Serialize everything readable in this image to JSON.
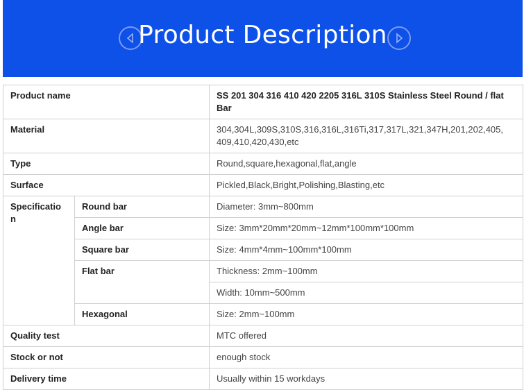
{
  "banner": {
    "title": "Product Description",
    "bg_color": "#0e51e8",
    "prev_icon": "triangle-left-circle-icon",
    "next_icon": "triangle-right-circle-icon"
  },
  "table": {
    "product_name": {
      "label": "Product name",
      "value": "SS 201 304 316 410 420 2205 316L 310S Stainless Steel Round / flat Bar"
    },
    "material": {
      "label": "Material",
      "value": "304,304L,309S,310S,316,316L,316Ti,317,317L,321,347H,201,202,405, 409,410,420,430,etc"
    },
    "type": {
      "label": "Type",
      "value": "Round,square,hexagonal,flat,angle"
    },
    "surface": {
      "label": "Surface",
      "value": "Pickled,Black,Bright,Polishing,Blasting,etc"
    },
    "specification": {
      "label": "Specificatio n",
      "round_bar": {
        "label": "Round bar",
        "value": "Diameter: 3mm~800mm"
      },
      "angle_bar": {
        "label": "Angle bar",
        "value": "Size: 3mm*20mm*20mm~12mm*100mm*100mm"
      },
      "square_bar": {
        "label": "Square bar",
        "value": "Size: 4mm*4mm~100mm*100mm"
      },
      "flat_bar": {
        "label": "Flat bar",
        "thickness": "Thickness: 2mm~100mm",
        "width": "Width: 10mm~500mm"
      },
      "hexagonal": {
        "label": "Hexagonal",
        "value": "Size: 2mm~100mm"
      }
    },
    "quality_test": {
      "label": "Quality test",
      "value": "MTC offered"
    },
    "stock": {
      "label": "Stock or not",
      "value": "enough stock"
    },
    "delivery": {
      "label": "Delivery time",
      "value": "Usually within 15 workdays"
    }
  }
}
